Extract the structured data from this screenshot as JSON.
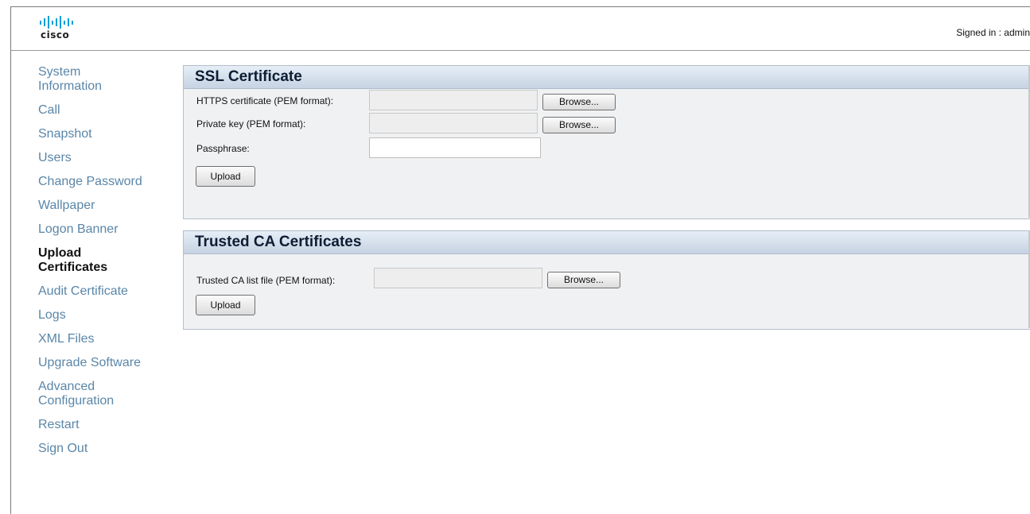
{
  "header": {
    "logo_text": "cisco",
    "signed_in": "Signed in : admin"
  },
  "sidebar": {
    "items": [
      {
        "label": "System Information",
        "active": false
      },
      {
        "label": "Call",
        "active": false
      },
      {
        "label": "Snapshot",
        "active": false
      },
      {
        "label": "Users",
        "active": false
      },
      {
        "label": "Change Password",
        "active": false
      },
      {
        "label": "Wallpaper",
        "active": false
      },
      {
        "label": "Logon Banner",
        "active": false
      },
      {
        "label": "Upload Certificates",
        "active": true
      },
      {
        "label": "Audit Certificate",
        "active": false
      },
      {
        "label": "Logs",
        "active": false
      },
      {
        "label": "XML Files",
        "active": false
      },
      {
        "label": "Upgrade Software",
        "active": false
      },
      {
        "label": "Advanced Configuration",
        "active": false
      },
      {
        "label": "Restart",
        "active": false
      },
      {
        "label": "Sign Out",
        "active": false
      }
    ]
  },
  "ssl": {
    "title": "SSL Certificate",
    "https_label": "HTTPS certificate (PEM format):",
    "https_value": "",
    "private_key_label": "Private key (PEM format):",
    "private_key_value": "",
    "passphrase_label": "Passphrase:",
    "passphrase_value": "",
    "browse_label": "Browse...",
    "upload_label": "Upload"
  },
  "trusted": {
    "title": "Trusted CA Certificates",
    "list_label": "Trusted CA list file (PEM format):",
    "list_value": "",
    "browse_label": "Browse...",
    "upload_label": "Upload"
  },
  "colors": {
    "nav_link": "#5a86a8",
    "logo_bars": "#049fd9",
    "panel_bg": "#eff1f3"
  }
}
